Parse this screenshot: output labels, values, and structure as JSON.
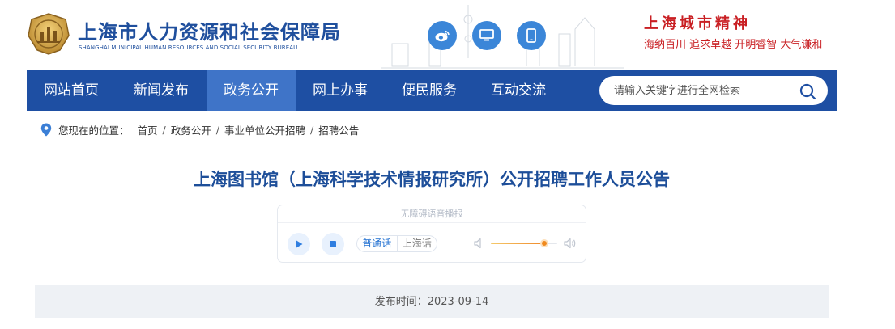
{
  "header": {
    "title": "上海市人力资源和社会保障局",
    "subtitle": "SHANGHAI MUNICIPAL HUMAN RESOURCES AND SOCIAL SECURITY BUREAU",
    "spirit_title": "上海城市精神",
    "spirit_motto": "海纳百川  追求卓越  开明睿智  大气谦和",
    "buttons": [
      "weibo-icon",
      "desktop-icon",
      "mobile-icon"
    ]
  },
  "nav": {
    "items": [
      {
        "label": "网站首页"
      },
      {
        "label": "新闻发布"
      },
      {
        "label": "政务公开"
      },
      {
        "label": "网上办事"
      },
      {
        "label": "便民服务"
      },
      {
        "label": "互动交流"
      }
    ],
    "active_index": 2,
    "search": {
      "placeholder": "请输入关键字进行全网检索",
      "value": ""
    }
  },
  "breadcrumb": {
    "label": "您现在的位置：",
    "items": [
      "首页",
      "政务公开",
      "事业单位公开招聘",
      "招聘公告"
    ]
  },
  "article": {
    "title": "上海图书馆（上海科学技术情报研究所）公开招聘工作人员公告",
    "player": {
      "label": "无障碍语音播报",
      "lang_mandarin": "普通话",
      "lang_shanghainese": "上海话",
      "active_lang": "普通话",
      "volume": 0.8
    },
    "publish": "发布时间：2023-09-14"
  },
  "colors": {
    "brand_blue": "#1e4fa3",
    "nav_active": "#3f74c8",
    "title_blue": "#1d4e99",
    "spirit_red": "#c91f23",
    "volume_orange": "#f08a1e"
  }
}
